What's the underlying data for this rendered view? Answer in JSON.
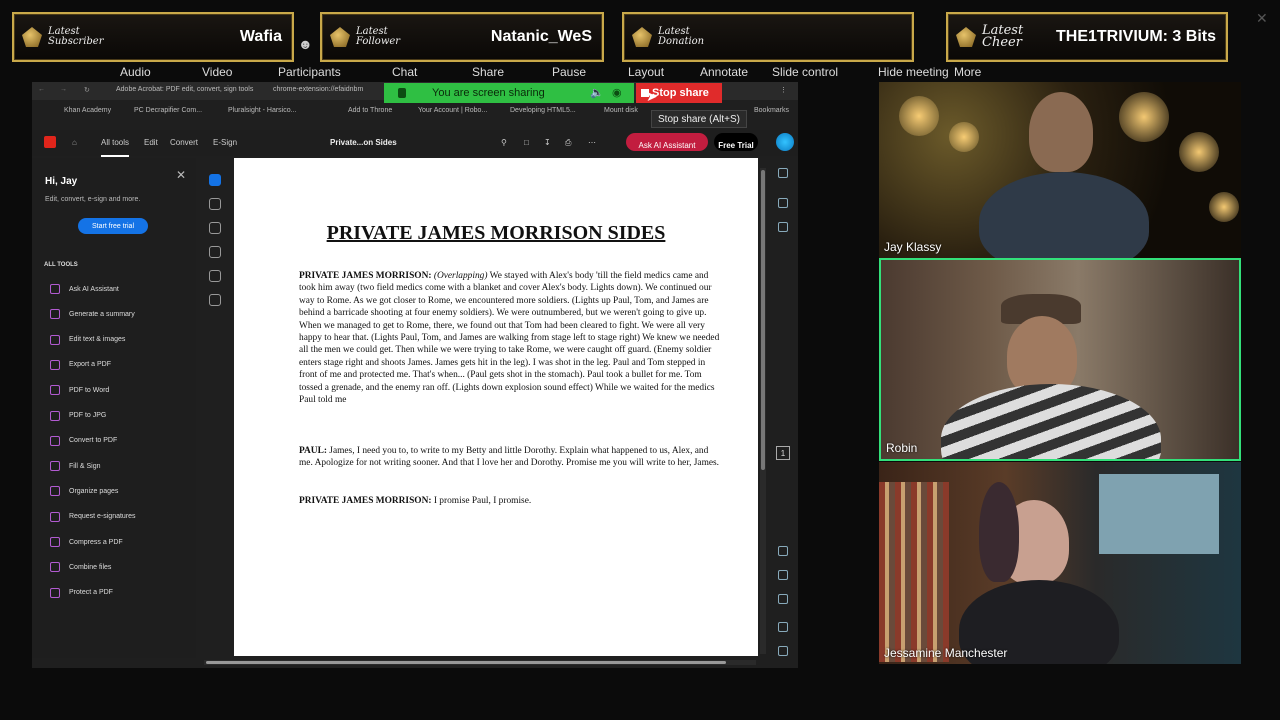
{
  "overlay": {
    "subscriber": {
      "tag": "Latest Subscriber",
      "value": "Wafia"
    },
    "follower": {
      "tag": "Latest Follower",
      "value": "Natanic_WeS"
    },
    "donation": {
      "tag": "Latest Donation",
      "value": ""
    },
    "cheer": {
      "tag": "Latest Cheer",
      "value": "THE1TRIVIUM: 3 Bits"
    }
  },
  "meeting_toolbar": {
    "items": [
      "Audio",
      "Video",
      "Participants",
      "Chat",
      "Share",
      "Pause",
      "Layout",
      "Annotate",
      "Slide control",
      "Hide meeting",
      "More"
    ]
  },
  "share": {
    "status": "You are screen sharing",
    "stop_label": "Stop share",
    "tooltip": "Stop share (Alt+S)"
  },
  "browser": {
    "tab_title": "Adobe Acrobat: PDF edit, convert, sign tools",
    "url": "chrome-extension://efaidnbm",
    "bookmarks": [
      "Khan Academy",
      "PC Decrapifier Com...",
      "Pluralsight - Harsico...",
      "Add to Throne",
      "Your Account | Robo...",
      "Developing HTML5...",
      "Mount disk",
      "Bookmarks"
    ]
  },
  "acrobat": {
    "tabs": [
      "All tools",
      "Edit",
      "Convert",
      "E-Sign"
    ],
    "doc_name": "Private...on Sides",
    "ask_ai": "Ask AI Assistant",
    "free_trial": "Free Trial",
    "panel": {
      "greeting": "Hi, Jay",
      "subtitle": "Edit, convert, e-sign and more.",
      "trial_button": "Start free trial",
      "section": "ALL TOOLS",
      "tools": [
        "Ask AI Assistant",
        "Generate a summary",
        "Edit text & images",
        "Export a PDF",
        "PDF to Word",
        "PDF to JPG",
        "Convert to PDF",
        "Fill & Sign",
        "Organize pages",
        "Request e-signatures",
        "Compress a PDF",
        "Combine files",
        "Protect a PDF"
      ]
    },
    "page_number": "1"
  },
  "document": {
    "title": "PRIVATE JAMES MORRISON SIDES",
    "p1_speaker": "PRIVATE JAMES MORRISON:",
    "p1_dir": "(Overlapping)",
    "p1_text": "We stayed with Alex's body 'till the field medics came and took him away (two field medics come with a blanket and cover Alex's body. Lights down). We continued our way to Rome. As we got closer to Rome, we encountered more soldiers. (Lights up Paul, Tom, and James are behind a barricade shooting at four enemy soldiers). We were outnumbered, but we weren't going to give up. When we managed to get to Rome, there, we found out that Tom had been cleared to fight. We were all very happy to hear that. (Lights Paul, Tom, and James are walking from stage left to stage right) We knew we needed all the men we could get. Then while we were trying to take Rome, we were caught off guard. (Enemy soldier enters stage right and shoots James. James gets hit in the leg). I was shot in the leg. Paul and Tom stepped in front of me and protected me. That's when... (Paul gets shot in the stomach). Paul took a bullet for me. Tom tossed a grenade, and the enemy ran off. (Lights down explosion sound effect) While we waited for the medics Paul told me",
    "p2_speaker": "PAUL:",
    "p2_text": "James, I need you to, to write to my Betty and little Dorothy. Explain what happened to us, Alex, and me. Apologize for not writing sooner. And that I love her and Dorothy. Promise me you will write to her, James.",
    "p3_speaker": "PRIVATE JAMES MORRISON:",
    "p3_text": "I promise Paul, I promise."
  },
  "participants": [
    {
      "name": "Jay Klassy"
    },
    {
      "name": "Robin"
    },
    {
      "name": "Jessamine Manchester"
    }
  ]
}
